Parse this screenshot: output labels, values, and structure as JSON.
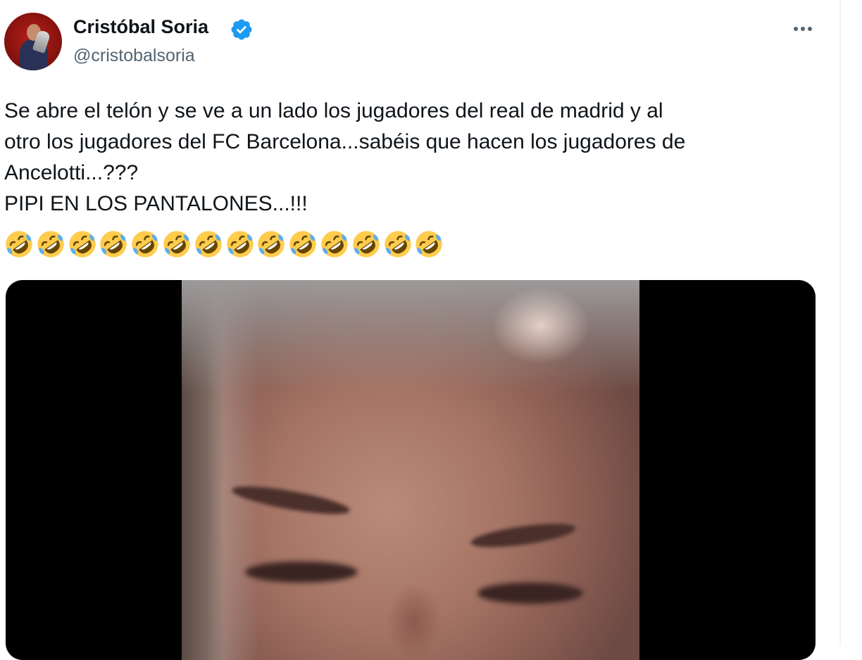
{
  "tweet": {
    "author": {
      "display_name": "Cristóbal Soria",
      "handle": "@cristobalsoria",
      "verified": true
    },
    "text_lines": [
      "Se abre el telón y se ve a un lado los jugadores del real de madrid y al",
      "otro los jugadores del FC Barcelona...sabéis que hacen los jugadores de",
      "Ancelotti...???",
      "PIPI EN LOS PANTALONES...!!!"
    ],
    "emoji": {
      "name": "rolling-on-the-floor-laughing",
      "count": 14
    },
    "media": {
      "type": "video"
    }
  },
  "colors": {
    "text": "#0f1419",
    "secondary_text": "#536471",
    "verified_badge": "#1d9bf0",
    "media_background": "#000000",
    "emoji_face": "#ffcc4d",
    "emoji_tears": "#5dadec"
  },
  "icons": {
    "verified": "verified-badge-icon",
    "more": "more-options-icon"
  }
}
